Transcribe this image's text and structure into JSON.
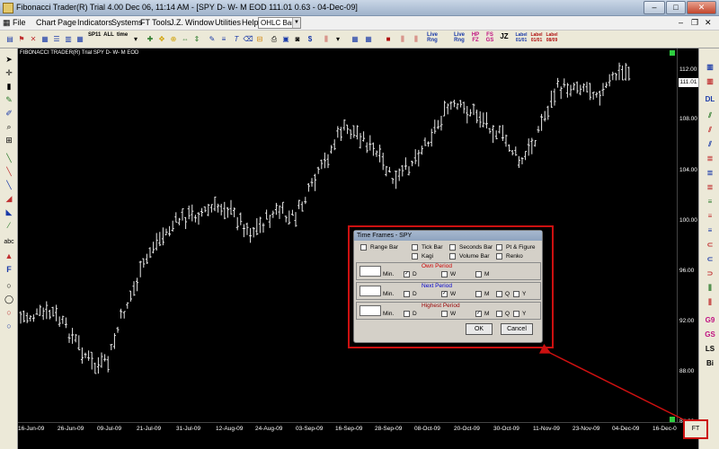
{
  "window": {
    "title": "Fibonacci Trader(R) Trial 4.00 Dec 06,  11:14 AM - [SPY D- W- M EOD  111.01   0.63 - 04-Dec-09]",
    "min": "–",
    "max": "□",
    "close": "✕"
  },
  "menu": {
    "items": [
      "File",
      "Chart",
      "Page",
      "Indicators",
      "Systems",
      "FT Tools",
      "J.Z.",
      "Window",
      "Utilities",
      "Help"
    ],
    "dropdown_value": "OHLC Bar",
    "mdi_min": "–",
    "mdi_restore": "❐",
    "mdi_close": "✕"
  },
  "toolbar": {
    "text_buttons": [
      "SP11",
      "ALL",
      "time",
      "Live Rng",
      "Live Rng",
      "HP FZ",
      "FS GS",
      "JZ",
      "Label 01/01",
      "Label 01/01",
      "Label 08/09"
    ]
  },
  "chart": {
    "header": "FIBONACCI TRADER(R) Trial     SPY D- W- M EOD",
    "current_price": "111.01",
    "y_labels": [
      "112.00",
      "108.00",
      "104.00",
      "100.00",
      "96.00",
      "92.00",
      "88.00",
      "84.00"
    ],
    "x_labels": [
      "16-Jun-09",
      "26-Jun-09",
      "09-Jul-09",
      "21-Jul-09",
      "31-Jul-09",
      "12-Aug-09",
      "24-Aug-09",
      "03-Sep-09",
      "16-Sep-09",
      "28-Sep-09",
      "08-Oct-09",
      "20-Oct-09",
      "30-Oct-09",
      "11-Nov-09",
      "23-Nov-09",
      "04-Dec-09",
      "16-Dec-0"
    ]
  },
  "dialog": {
    "title": "Time Frames - SPY",
    "bar_types": [
      "Range Bar",
      "Tick Bar",
      "Seconds Bar",
      "Pt & Figure",
      "Kagi",
      "Volume Bar",
      "Renko"
    ],
    "own_period": "Own Period",
    "next_period": "Next Period",
    "highest_period": "Highest Period",
    "min_label": "Min.",
    "d": "D",
    "w": "W",
    "m": "M",
    "q": "Q",
    "y": "Y",
    "check": "✓",
    "ok": "OK",
    "cancel": "Cancel"
  },
  "right_toolbar": [
    "DL",
    "G9",
    "GS",
    "LS",
    "Bi"
  ],
  "left_toolbar": [
    "abc",
    "F"
  ],
  "ft_button": "FT",
  "colors": {
    "own_period": "#cc0000",
    "next_period": "#0000cc",
    "highest_period": "#990000",
    "frame": "#cc1010"
  }
}
